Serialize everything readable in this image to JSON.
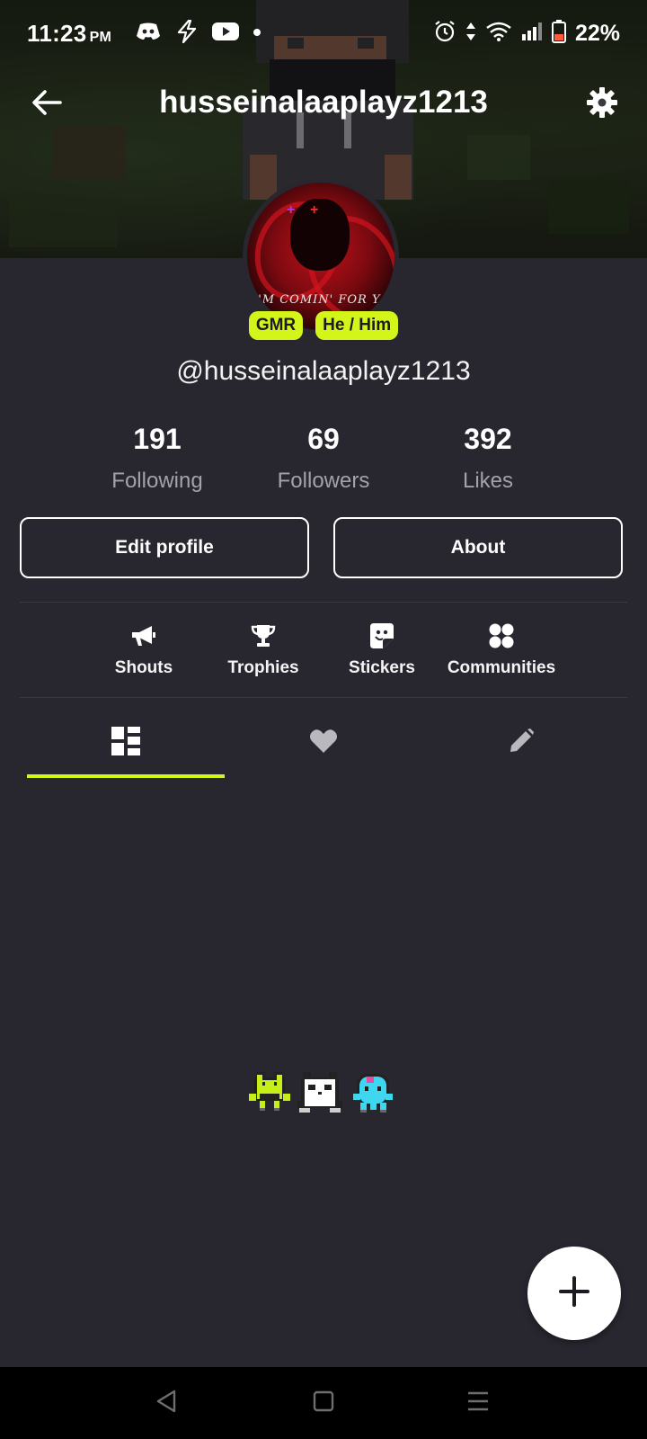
{
  "status_bar": {
    "time": "11:23",
    "ampm": "PM",
    "left_icons": [
      "discord-icon",
      "lightning-app-icon",
      "youtube-icon",
      "notification-dot-icon"
    ],
    "right_icons": [
      "alarm-icon",
      "data-arrows-icon",
      "wifi-icon",
      "signal-icon",
      "battery-low-icon"
    ],
    "battery": "22%"
  },
  "header": {
    "title": "husseinalaaplayz1213",
    "back_icon": "arrow-left-icon",
    "settings_icon": "gear-icon"
  },
  "profile": {
    "avatar_caption": "I'M COMIN' FOR YA",
    "badges": [
      "GMR",
      "He / Him"
    ],
    "handle": "@husseinalaaplayz1213"
  },
  "stats": [
    {
      "value": "191",
      "label": "Following"
    },
    {
      "value": "69",
      "label": "Followers"
    },
    {
      "value": "392",
      "label": "Likes"
    }
  ],
  "actions": {
    "edit_profile": "Edit profile",
    "about": "About"
  },
  "quick_links": [
    {
      "label": "Shouts",
      "icon": "megaphone-icon"
    },
    {
      "label": "Trophies",
      "icon": "trophy-icon"
    },
    {
      "label": "Stickers",
      "icon": "sticker-icon"
    },
    {
      "label": "Communities",
      "icon": "communities-icon"
    }
  ],
  "tabs": [
    {
      "name": "posts",
      "icon": "grid-layout-icon",
      "active": true
    },
    {
      "name": "likes",
      "icon": "heart-icon",
      "active": false
    },
    {
      "name": "drafts",
      "icon": "pencil-icon",
      "active": false
    }
  ],
  "empty_state": {
    "art": [
      "green-frog-pixel",
      "panda-pixel",
      "cyan-ghost-pixel"
    ]
  },
  "fab": {
    "icon": "plus-icon"
  },
  "colors": {
    "background": "#28262f",
    "accent": "#d4f51a",
    "muted_text": "#a3a1ab",
    "text": "#ffffff"
  }
}
